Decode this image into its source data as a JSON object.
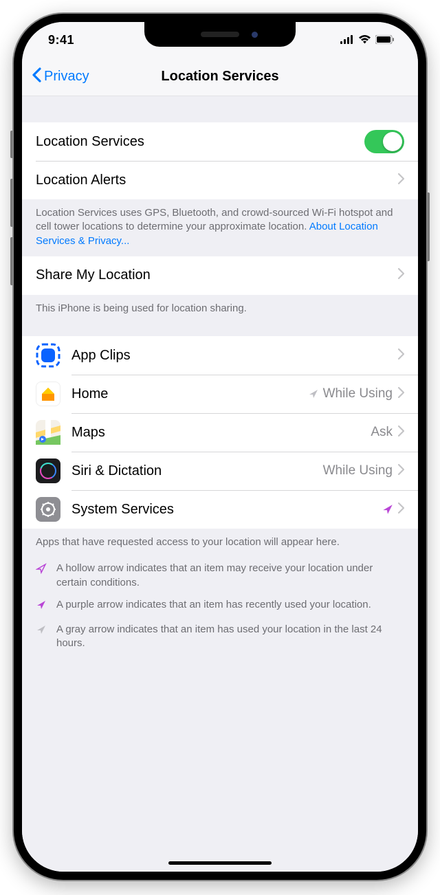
{
  "status": {
    "time": "9:41"
  },
  "nav": {
    "back": "Privacy",
    "title": "Location Services"
  },
  "main_toggle": {
    "label": "Location Services",
    "on": true
  },
  "alerts": {
    "label": "Location Alerts"
  },
  "footer1": {
    "text": "Location Services uses GPS, Bluetooth, and crowd-sourced Wi-Fi hotspot and cell tower locations to determine your approximate location. ",
    "link": "About Location Services & Privacy..."
  },
  "share": {
    "label": "Share My Location"
  },
  "footer2": "This iPhone is being used for location sharing.",
  "apps": [
    {
      "name": "App Clips",
      "value": "",
      "indicator": ""
    },
    {
      "name": "Home",
      "value": "While Using",
      "indicator": "gray"
    },
    {
      "name": "Maps",
      "value": "Ask",
      "indicator": ""
    },
    {
      "name": "Siri & Dictation",
      "value": "While Using",
      "indicator": ""
    },
    {
      "name": "System Services",
      "value": "",
      "indicator": "purple"
    }
  ],
  "footer3": "Apps that have requested access to your location will appear here.",
  "legend": [
    {
      "type": "hollow",
      "text": "A hollow arrow indicates that an item may receive your location under certain conditions."
    },
    {
      "type": "purple",
      "text": "A purple arrow indicates that an item has recently used your location."
    },
    {
      "type": "gray",
      "text": "A gray arrow indicates that an item has used your location in the last 24 hours."
    }
  ]
}
